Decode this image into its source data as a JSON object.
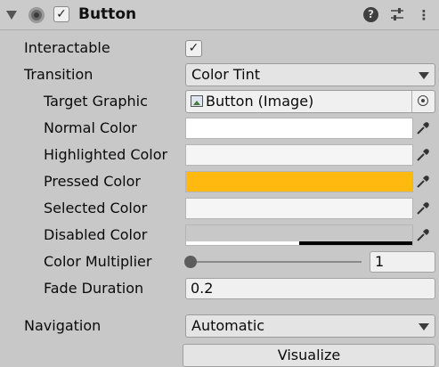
{
  "header": {
    "title": "Button",
    "enabled": true,
    "help_icon": "help-icon",
    "presets_icon": "sliders-icon",
    "menu_icon": "kebab-menu-icon",
    "help_glyph": "?",
    "presets_glyph": "⇅",
    "menu_glyph": "⋮"
  },
  "fields": {
    "interactable": {
      "label": "Interactable",
      "checked": true,
      "check_glyph": "✓"
    },
    "transition": {
      "label": "Transition",
      "value": "Color Tint"
    },
    "target_graphic": {
      "label": "Target Graphic",
      "value": "Button (Image)"
    },
    "normal_color": {
      "label": "Normal Color",
      "color": "#ffffff"
    },
    "highlighted_color": {
      "label": "Highlighted Color",
      "color": "#f5f5f5"
    },
    "pressed_color": {
      "label": "Pressed Color",
      "color": "#ffb90f"
    },
    "selected_color": {
      "label": "Selected Color",
      "color": "#f5f5f5"
    },
    "disabled_color": {
      "label": "Disabled Color",
      "color": "#c8c8c8",
      "alpha": 0.5
    },
    "color_multiplier": {
      "label": "Color Multiplier",
      "value": "1",
      "slider_min": 1,
      "slider_max": 5,
      "slider_value": 1
    },
    "fade_duration": {
      "label": "Fade Duration",
      "value": "0.2"
    },
    "navigation": {
      "label": "Navigation",
      "value": "Automatic"
    },
    "visualize": {
      "label": "Visualize"
    }
  }
}
